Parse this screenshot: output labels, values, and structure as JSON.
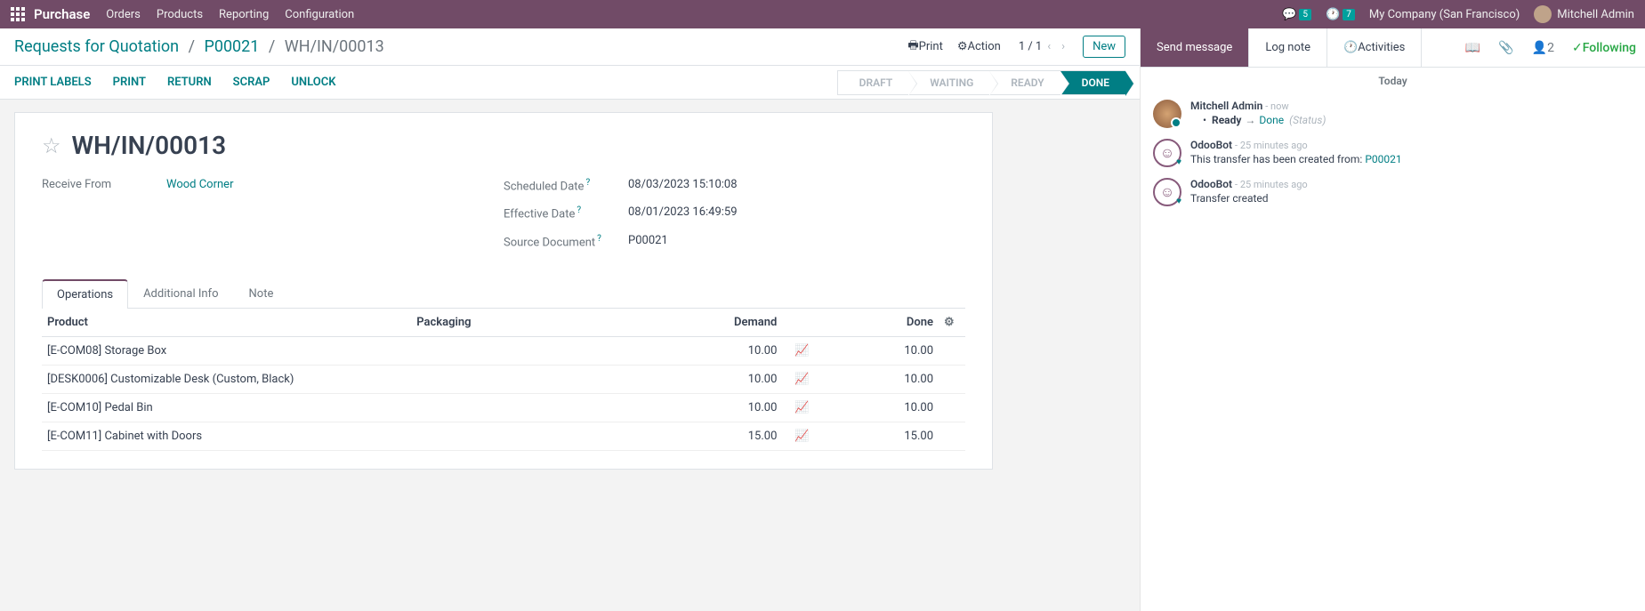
{
  "topnav": {
    "brand": "Purchase",
    "menu": [
      "Orders",
      "Products",
      "Reporting",
      "Configuration"
    ],
    "chat_badge": "5",
    "activity_badge": "7",
    "company": "My Company (San Francisco)",
    "user": "Mitchell Admin"
  },
  "breadcrumb": {
    "root": "Requests for Quotation",
    "parent": "P00021",
    "current": "WH/IN/00013"
  },
  "cp": {
    "print": "Print",
    "action": "Action",
    "pager": "1 / 1",
    "new": "New"
  },
  "btnbar": [
    "PRINT LABELS",
    "PRINT",
    "RETURN",
    "SCRAP",
    "UNLOCK"
  ],
  "status_steps": [
    "DRAFT",
    "WAITING",
    "READY",
    "DONE"
  ],
  "form": {
    "title": "WH/IN/00013",
    "receive_from_label": "Receive From",
    "receive_from_value": "Wood Corner",
    "scheduled_label": "Scheduled Date",
    "scheduled_value": "08/03/2023 15:10:08",
    "effective_label": "Effective Date",
    "effective_value": "08/01/2023 16:49:59",
    "source_label": "Source Document",
    "source_value": "P00021"
  },
  "tabs": [
    "Operations",
    "Additional Info",
    "Note"
  ],
  "table": {
    "headers": {
      "product": "Product",
      "packaging": "Packaging",
      "demand": "Demand",
      "done": "Done"
    },
    "rows": [
      {
        "product": "[E-COM08] Storage Box",
        "demand": "10.00",
        "done": "10.00"
      },
      {
        "product": "[DESK0006] Customizable Desk (Custom, Black)",
        "demand": "10.00",
        "done": "10.00"
      },
      {
        "product": "[E-COM10] Pedal Bin",
        "demand": "10.00",
        "done": "10.00"
      },
      {
        "product": "[E-COM11] Cabinet with Doors",
        "demand": "15.00",
        "done": "15.00"
      }
    ]
  },
  "chatter": {
    "send": "Send message",
    "log": "Log note",
    "activities": "Activities",
    "followers": "2",
    "following": "Following",
    "today": "Today",
    "messages": [
      {
        "author": "Mitchell Admin",
        "time": "now",
        "type": "status",
        "from": "Ready",
        "to": "Done",
        "field": "(Status)"
      },
      {
        "author": "OdooBot",
        "time": "25 minutes ago",
        "type": "text",
        "text_prefix": "This transfer has been created from: ",
        "link": "P00021"
      },
      {
        "author": "OdooBot",
        "time": "25 minutes ago",
        "type": "text",
        "text_prefix": "Transfer created",
        "link": ""
      }
    ]
  }
}
